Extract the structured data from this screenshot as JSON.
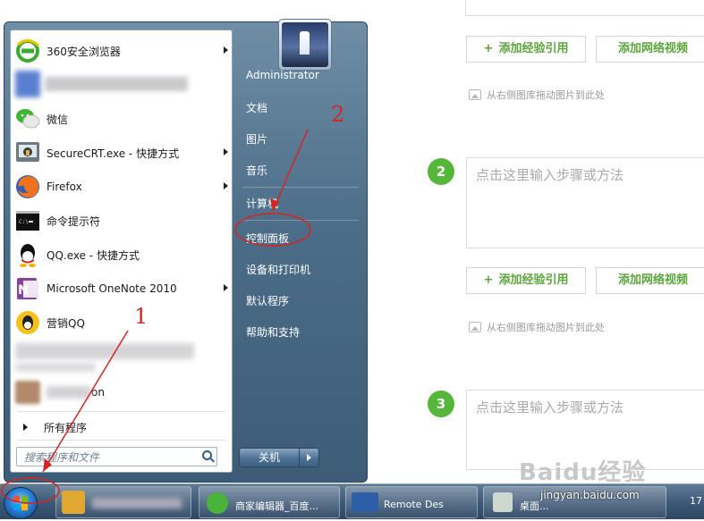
{
  "editor": {
    "add_experience_ref": "添加经验引用",
    "add_video": "添加网络视频",
    "image_hint": "从右侧图库拖动图片到此处",
    "steps": [
      {
        "number": "2",
        "placeholder": "点击这里输入步骤或方法"
      },
      {
        "number": "3",
        "placeholder": "点击这里输入步骤或方法"
      }
    ]
  },
  "start_menu": {
    "programs": [
      {
        "label": "360安全浏览器",
        "icon": "360-browser-icon",
        "has_submenu": true
      },
      {
        "label": "微信",
        "icon": "wechat-icon",
        "has_submenu": false
      },
      {
        "label": "SecureCRT.exe - 快捷方式",
        "icon": "securecrt-icon",
        "has_submenu": true
      },
      {
        "label": "Firefox",
        "icon": "firefox-icon",
        "has_submenu": true
      },
      {
        "label": "命令提示符",
        "icon": "command-prompt-icon",
        "has_submenu": false
      },
      {
        "label": "QQ.exe - 快捷方式",
        "icon": "qq-icon",
        "has_submenu": false
      },
      {
        "label": "Microsoft OneNote 2010",
        "icon": "onenote-icon",
        "has_submenu": true
      },
      {
        "label": "营销QQ",
        "icon": "marketing-qq-icon",
        "has_submenu": false
      },
      {
        "label": "on",
        "icon": "blurred-app-icon",
        "has_submenu": false
      }
    ],
    "all_programs": "所有程序",
    "search_placeholder": "搜索程序和文件",
    "right_items": [
      "Administrator",
      "文档",
      "图片",
      "音乐",
      "计算机",
      "控制面板",
      "设备和打印机",
      "默认程序",
      "帮助和支持"
    ],
    "shutdown": "关机"
  },
  "taskbar": {
    "items": [
      "商家编辑器_百度...",
      "Remote Des",
      "桌面..."
    ],
    "clock": "17"
  },
  "annotations": {
    "marker_1": "1",
    "marker_2": "2",
    "color": "#d8241f"
  },
  "watermark": {
    "brand": "Baidu经验",
    "url": "jingyan.baidu.com"
  }
}
